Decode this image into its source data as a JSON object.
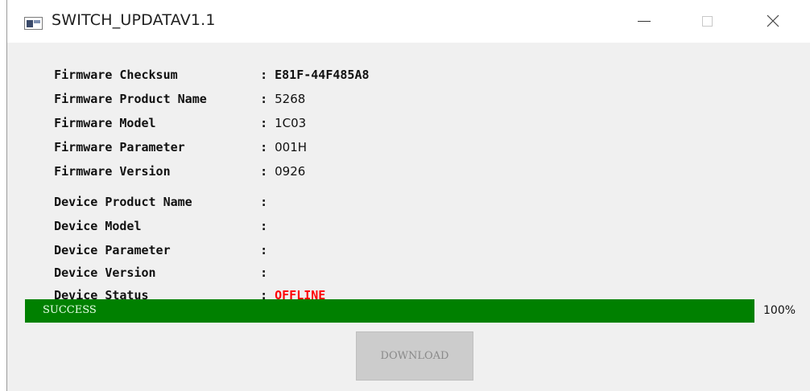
{
  "window": {
    "title": "SWITCH_UPDATAV1.1",
    "icons": {
      "app": "app-window-icon",
      "minimize": "minimize-icon",
      "maximize": "maximize-icon",
      "close": "close-icon"
    }
  },
  "firmware": [
    {
      "label": "Firmware Checksum",
      "value": "E81F-44F485A8"
    },
    {
      "label": "Firmware Product Name",
      "value": "5268"
    },
    {
      "label": "Firmware Model",
      "value": "1C03"
    },
    {
      "label": "Firmware Parameter",
      "value": "001H"
    },
    {
      "label": "Firmware Version",
      "value": "0926"
    }
  ],
  "device": [
    {
      "label": "Device Product Name",
      "value": ""
    },
    {
      "label": "Device Model",
      "value": ""
    },
    {
      "label": "Device Parameter",
      "value": ""
    },
    {
      "label": "Device Version",
      "value": ""
    },
    {
      "label": "Device Status",
      "value": "OFFLINE"
    }
  ],
  "progress": {
    "status_text": "SUCCESS",
    "percent_label": "100%",
    "fraction": 1.0,
    "color": "#008000"
  },
  "download_button": {
    "label": "DOWNLOAD",
    "enabled": false
  },
  "colors": {
    "status_offline": "#ff0000",
    "progress_fill": "#008000"
  }
}
